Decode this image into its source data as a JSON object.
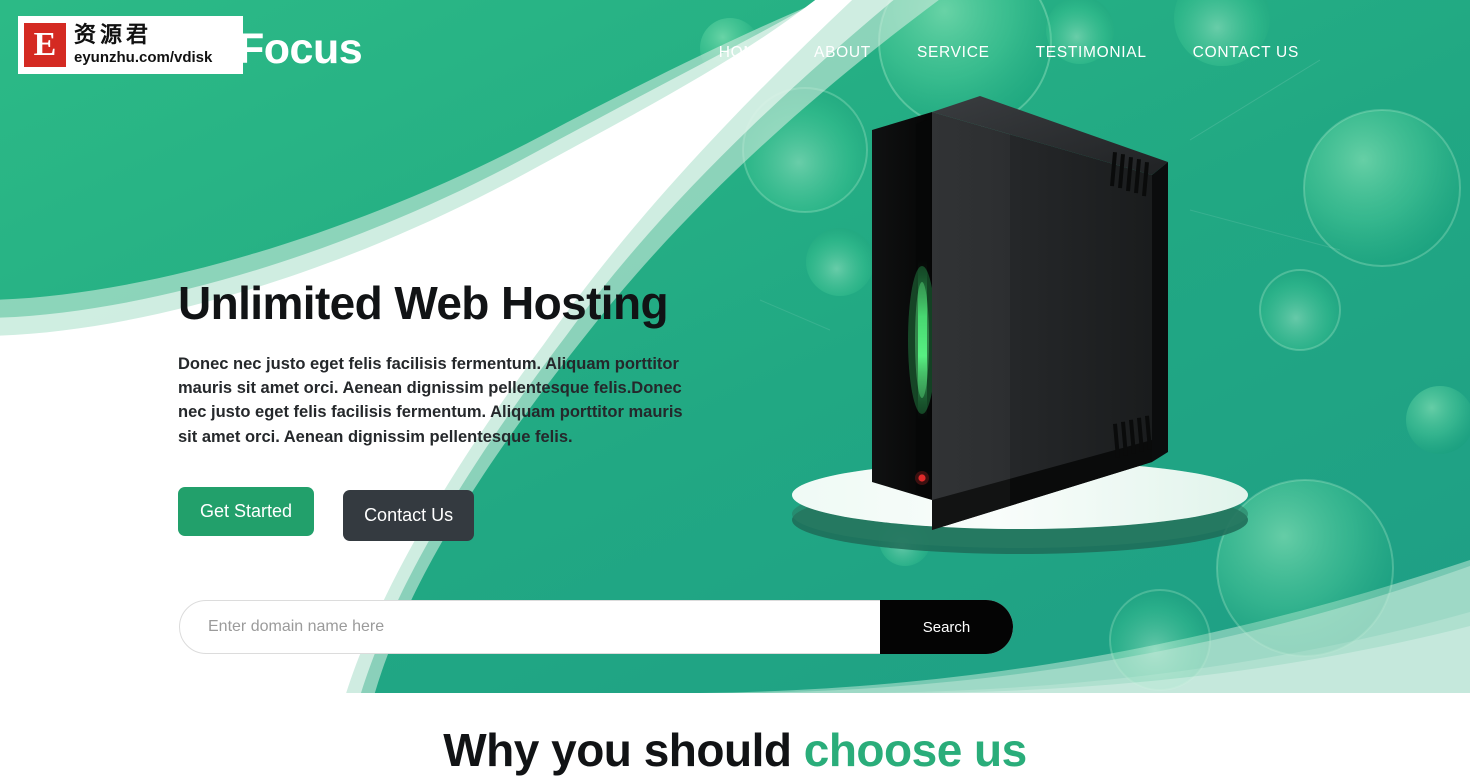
{
  "brand": {
    "logo_icon": "focus-logo-mark",
    "name": "Focus"
  },
  "nav": {
    "items": [
      {
        "label": "HOME"
      },
      {
        "label": "ABOUT"
      },
      {
        "label": "SERVICE"
      },
      {
        "label": "TESTIMONIAL"
      },
      {
        "label": "CONTACT US"
      }
    ]
  },
  "watermark": {
    "badge_letter": "E",
    "chinese": "资源君",
    "url": "eyunzhu.com/vdisk"
  },
  "hero": {
    "title": "Unlimited Web Hosting",
    "description": "Donec nec justo eget felis facilisis fermentum. Aliquam porttitor mauris sit amet orci. Aenean dignissim pellentesque felis.Donec nec justo eget felis facilisis fermentum. Aliquam porttitor mauris sit amet orci. Aenean dignissim pellentesque felis.",
    "primary_button": "Get Started",
    "secondary_button": "Contact Us",
    "illustration": "server-tower-on-pedestal"
  },
  "search": {
    "placeholder": "Enter domain name here",
    "value": "",
    "button_label": "Search"
  },
  "why_section": {
    "title_plain": "Why you should ",
    "title_accent": "choose us"
  },
  "colors": {
    "brand_green": "#22a06b",
    "hero_bg_teal": "#21a883",
    "hero_bg_teal_light": "#2dbd8a",
    "accent_green": "#2aad7a",
    "dark_button": "#343a40",
    "search_button": "#040404",
    "white": "#ffffff"
  }
}
